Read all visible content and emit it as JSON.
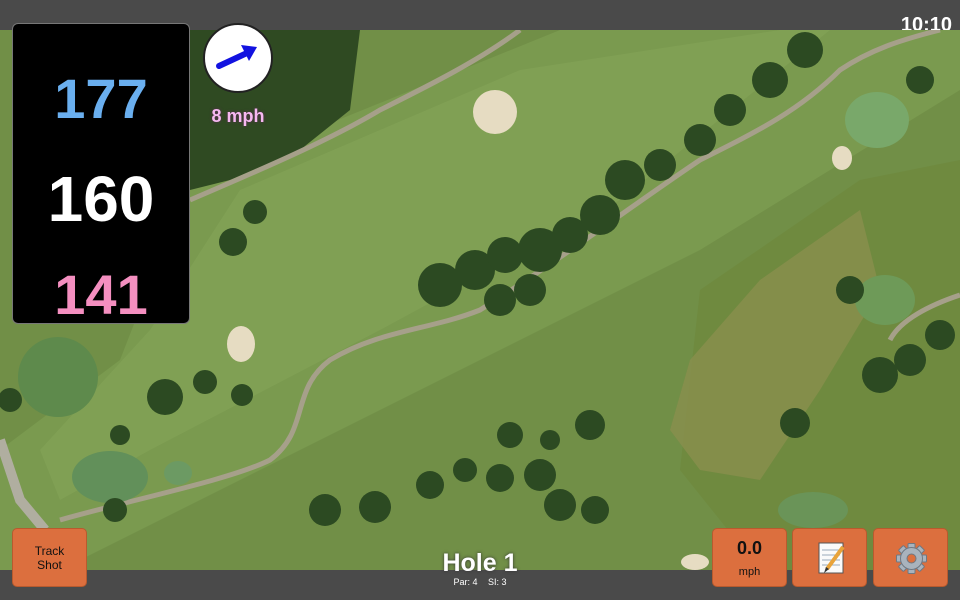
{
  "status_bar": {
    "time": "10:10"
  },
  "distances": {
    "back": "177",
    "middle": "160",
    "front": "141"
  },
  "wind": {
    "speed_label": "8 mph",
    "direction_icon": "arrow-icon"
  },
  "hole": {
    "title": "Hole 1",
    "par": "Par: 4",
    "stroke_index": "SI: 3"
  },
  "buttons": {
    "track_shot_line1": "Track",
    "track_shot_line2": "Shot",
    "speed_value": "0.0",
    "speed_unit": "mph",
    "notes_icon": "notepad-icon",
    "settings_icon": "gear-icon"
  },
  "colors": {
    "back_distance": "#6aafef",
    "middle_distance": "#ffffff",
    "front_distance": "#f48fc0",
    "button": "#dc6f3e",
    "wind_label": "#f6b8f1"
  }
}
